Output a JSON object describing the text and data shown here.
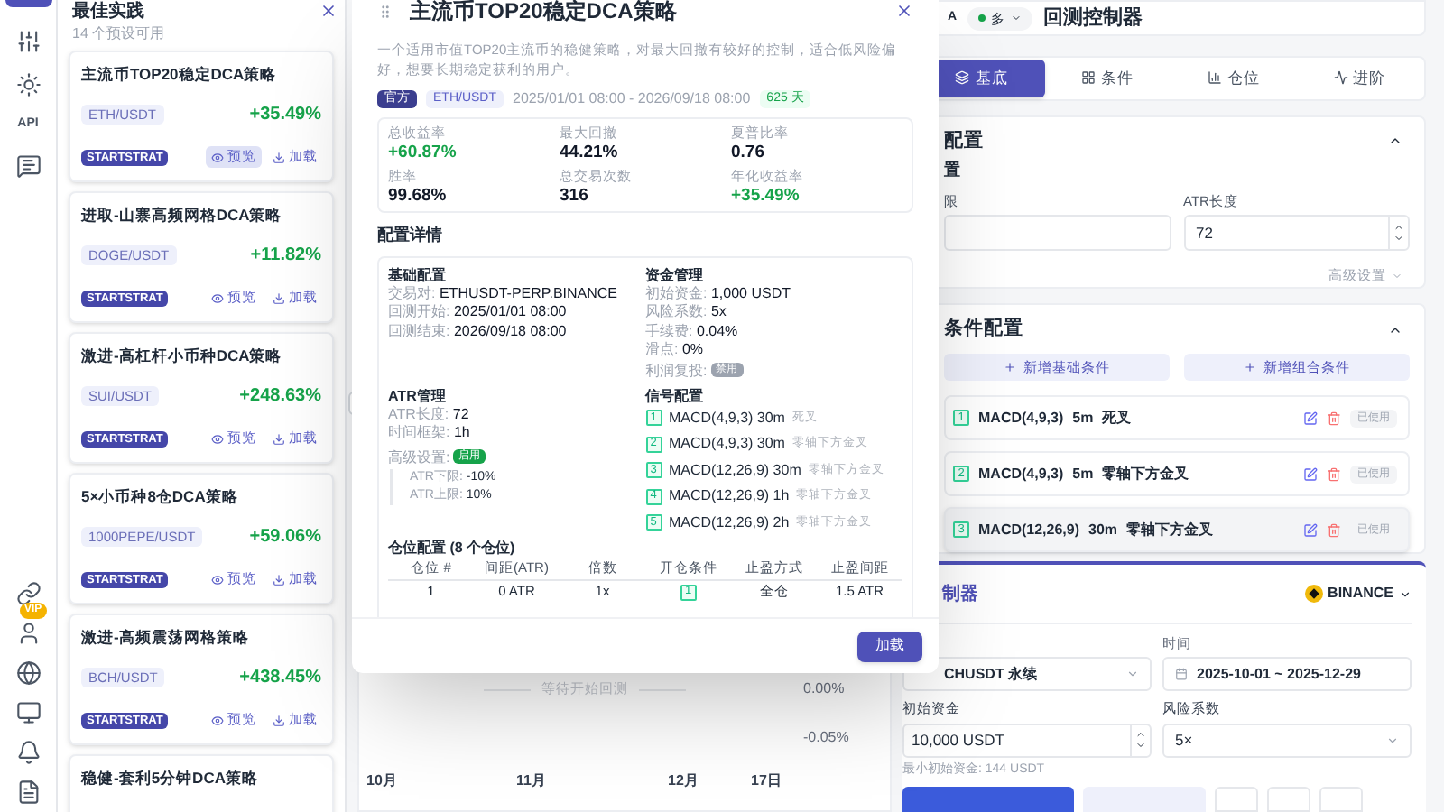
{
  "rail": {
    "api_label": "API",
    "vip_badge": "VIP"
  },
  "drawer": {
    "title": "最佳实践",
    "subtitle": "14 个预设可用",
    "cards": [
      {
        "title": "主流币TOP20稳定DCA策略",
        "pair": "ETH/USDT",
        "return": "+35.49%",
        "tag": "STARTSTRAT",
        "preview": "预览",
        "load": "加载",
        "highlighted": true
      },
      {
        "title": "进取-山寨高频网格DCA策略",
        "pair": "DOGE/USDT",
        "return": "+11.82%",
        "tag": "STARTSTRAT",
        "preview": "预览",
        "load": "加载",
        "highlighted": false
      },
      {
        "title": "激进-高杠杆小币种DCA策略",
        "pair": "SUI/USDT",
        "return": "+248.63%",
        "tag": "STARTSTRAT",
        "preview": "预览",
        "load": "加载",
        "highlighted": false
      },
      {
        "title": "5×小币种8仓DCA策略",
        "pair": "1000PEPE/USDT",
        "return": "+59.06%",
        "tag": "STARTSTRAT",
        "preview": "预览",
        "load": "加载",
        "highlighted": false
      },
      {
        "title": "激进-高频震荡网格策略",
        "pair": "BCH/USDT",
        "return": "+438.45%",
        "tag": "STARTSTRAT",
        "preview": "预览",
        "load": "加载",
        "highlighted": false
      },
      {
        "title": "稳健-套利5分钟DCA策略"
      }
    ]
  },
  "chart": {
    "message": "等待开始回测",
    "y_labels": [
      "0.00%",
      "-0.05%"
    ],
    "x_labels": [
      "10月",
      "11月",
      "12月",
      "17日"
    ]
  },
  "modal": {
    "title": "主流币TOP20稳定DCA策略",
    "description": "一个适用市值TOP20主流币的稳健策略，对最大回撤有较好的控制，适合低风险偏好，想要长期稳定获利的用户。",
    "tags": {
      "official": "官方",
      "pair": "ETH/USDT",
      "range": "2025/01/01 08:00 - 2026/09/18 08:00",
      "days": "625 天"
    },
    "stats": [
      {
        "label": "总收益率",
        "value": "+60.87%",
        "positive": true
      },
      {
        "label": "最大回撤",
        "value": "44.21%",
        "positive": false
      },
      {
        "label": "夏普比率",
        "value": "0.76",
        "positive": false
      },
      {
        "label": "胜率",
        "value": "99.68%",
        "positive": false
      },
      {
        "label": "总交易次数",
        "value": "316",
        "positive": false
      },
      {
        "label": "年化收益率",
        "value": "+35.49%",
        "positive": true
      }
    ],
    "section_title": "配置详情",
    "basic": {
      "title": "基础配置",
      "rows": [
        {
          "label": "交易对:",
          "value": "ETHUSDT-PERP.BINANCE"
        },
        {
          "label": "回测开始:",
          "value": "2025/01/01 08:00"
        },
        {
          "label": "回测结束:",
          "value": "2026/09/18 08:00"
        }
      ]
    },
    "funds": {
      "title": "资金管理",
      "rows": [
        {
          "label": "初始资金:",
          "value": "1,000 USDT"
        },
        {
          "label": "风险系数:",
          "value": "5x"
        },
        {
          "label": "手续费:",
          "value": "0.04%"
        },
        {
          "label": "滑点:",
          "value": "0%"
        }
      ],
      "reinvest": {
        "label": "利润复投:",
        "badge": "禁用",
        "enabled": false
      }
    },
    "atr": {
      "title": "ATR管理",
      "rows": [
        {
          "label": "ATR长度:",
          "value": "72"
        },
        {
          "label": "时间框架:",
          "value": "1h"
        }
      ],
      "advanced": {
        "label": "高级设置:",
        "badge": "启用",
        "enabled": true,
        "rows": [
          {
            "label": "ATR下限:",
            "value": "-10%"
          },
          {
            "label": "ATR上限:",
            "value": "10%"
          }
        ]
      }
    },
    "signals": {
      "title": "信号配置",
      "items": [
        {
          "num": "1",
          "text": "MACD(4,9,3) 30m",
          "desc": "死叉"
        },
        {
          "num": "2",
          "text": "MACD(4,9,3) 30m",
          "desc": "零轴下方金叉"
        },
        {
          "num": "3",
          "text": "MACD(12,26,9) 30m",
          "desc": "零轴下方金叉"
        },
        {
          "num": "4",
          "text": "MACD(12,26,9) 1h",
          "desc": "零轴下方金叉"
        },
        {
          "num": "5",
          "text": "MACD(12,26,9) 2h",
          "desc": "零轴下方金叉"
        }
      ]
    },
    "positions": {
      "title": "仓位配置 (8 个仓位)",
      "columns": [
        {
          "label": "仓位 #",
          "kind": "text"
        },
        {
          "label": "间距(ATR)",
          "kind": "text"
        },
        {
          "label": "倍数",
          "kind": "text"
        },
        {
          "label": "开仓条件",
          "kind": "badge"
        },
        {
          "label": "止盈方式",
          "kind": "text"
        },
        {
          "label": "止盈间距",
          "kind": "text"
        }
      ],
      "rows": [
        [
          "1",
          "0 ATR",
          "1x",
          "1",
          "全仓",
          "1.5 ATR"
        ]
      ]
    },
    "load_button": "加载"
  },
  "right": {
    "header": {
      "letter": "A",
      "direction": {
        "label": "多",
        "color": "#16a34a"
      },
      "title": "回测控制器"
    },
    "tabs": [
      {
        "label": "基底",
        "selected": true
      },
      {
        "label": "条件",
        "selected": false
      },
      {
        "label": "仓位",
        "selected": false
      },
      {
        "label": "进阶",
        "selected": false
      }
    ],
    "config_card": {
      "title": "配置",
      "subtitle": "置",
      "field_1_label": "限",
      "atr_label": "ATR长度",
      "atr_value": "72",
      "advanced": "高级设置"
    },
    "conditions_card": {
      "title": "条件配置",
      "add_buttons": [
        "新增基础条件",
        "新增组合条件"
      ],
      "items": [
        {
          "num": "1",
          "indicator": "MACD(4,9,3)",
          "timeframe": "5m",
          "signal": "死叉",
          "status": "已使用",
          "highlighted": false
        },
        {
          "num": "2",
          "indicator": "MACD(4,9,3)",
          "timeframe": "5m",
          "signal": "零轴下方金叉",
          "status": "已使用",
          "highlighted": false
        },
        {
          "num": "3",
          "indicator": "MACD(12,26,9)",
          "timeframe": "30m",
          "signal": "零轴下方金叉",
          "status": "已使用",
          "highlighted": true
        }
      ]
    },
    "controller": {
      "title": "制器",
      "exchange": "BINANCE",
      "symbol": "CHUSDT 永续",
      "time_label": "时间",
      "time": "2025-10-01 ~ 2025-12-29",
      "capital_label": "初始资金",
      "capital": "10,000 USDT",
      "risk_label": "风险系数",
      "risk": "5×",
      "hint": "最小初始资金: 144 USDT"
    }
  }
}
